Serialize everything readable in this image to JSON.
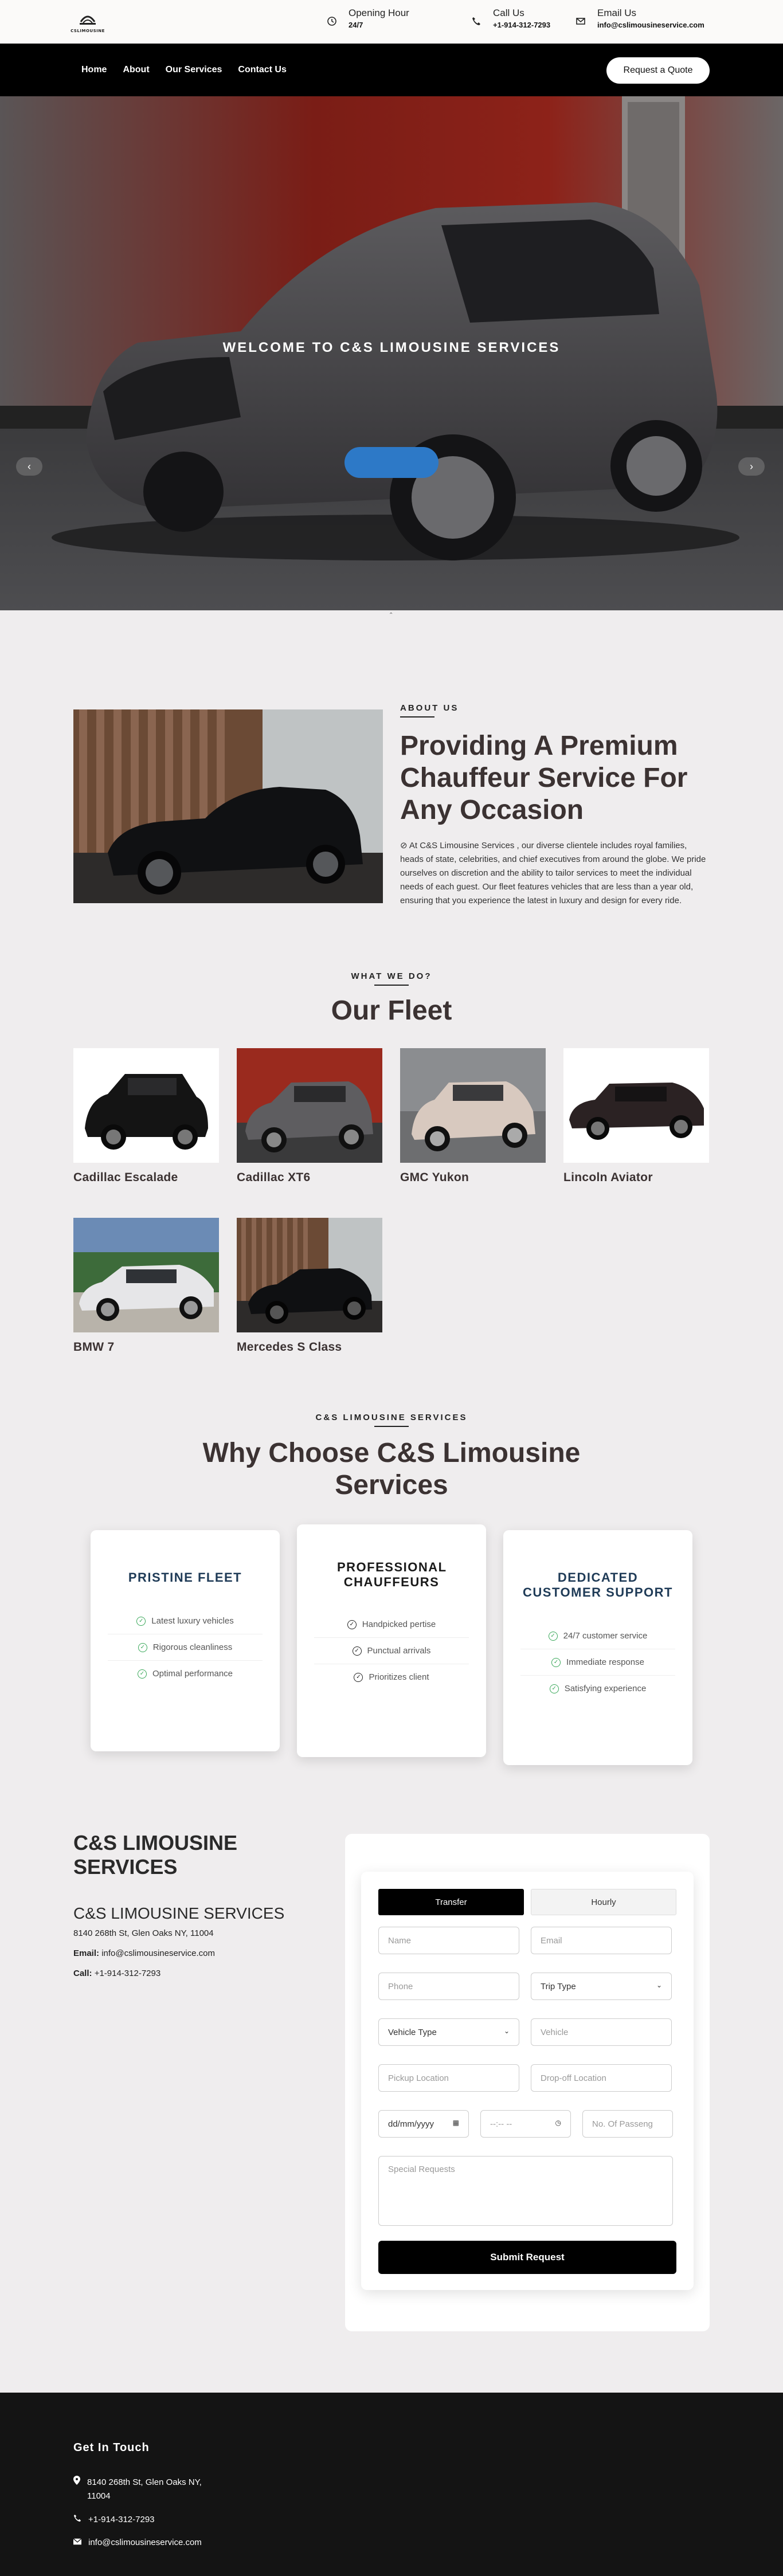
{
  "brand": {
    "logo_text": "CSLIMOUSINE"
  },
  "topbar": {
    "hours_label": "Opening Hour",
    "hours_value": "24/7",
    "call_label": "Call Us",
    "call_value": "+1-914-312-7293",
    "email_label": "Email Us",
    "email_value": "info@cslimousineservice.com"
  },
  "nav": {
    "items": [
      "Home",
      "About",
      "Our Services",
      "Contact Us"
    ],
    "quote_button": "Request a Quote"
  },
  "hero": {
    "title": "WELCOME TO C&S LIMOUSINE SERVICES",
    "prev": "‹",
    "next": "›",
    "dots": "⌃"
  },
  "about": {
    "tag": "ABOUT US",
    "heading": "Providing A Premium Chauffeur Service For Any Occasion",
    "body": "At C&S Limousine Services , our diverse clientele includes royal families, heads of state, celebrities, and chief executives from around the globe. We pride ourselves on discretion and the ability to tailor services to meet the individual needs of each guest. Our fleet features vehicles that are less than a year old, ensuring that you experience the latest in luxury and design for every ride."
  },
  "fleet": {
    "tag": "WHAT WE DO?",
    "heading": "Our Fleet",
    "cars": [
      "Cadillac Escalade",
      "Cadillac XT6",
      "GMC Yukon",
      "Lincoln Aviator",
      "BMW 7",
      "Mercedes S Class"
    ]
  },
  "why": {
    "tag": "C&S LIMOUSINE SERVICES",
    "heading": "Why Choose C&S Limousine Services",
    "cards": [
      {
        "title": "PRISTINE FLEET",
        "items": [
          "Latest luxury vehicles",
          "Rigorous cleanliness",
          "Optimal performance"
        ]
      },
      {
        "title": "PROFESSIONAL CHAUFFEURS",
        "items": [
          "Handpicked pertise",
          "Punctual arrivals",
          "Prioritizes client"
        ]
      },
      {
        "title": "DEDICATED CUSTOMER SUPPORT",
        "items": [
          "24/7 customer service",
          "Immediate response",
          "Satisfying experience"
        ]
      }
    ]
  },
  "company": {
    "title": "C&S LIMOUSINE SERVICES",
    "subtitle": "C&S LIMOUSINE SERVICES",
    "address": "8140 268th St, Glen Oaks NY, 11004",
    "email_label": "Email:",
    "email": "info@cslimousineservice.com",
    "call_label": "Call:",
    "call": "+1-914-312-7293"
  },
  "form": {
    "tab_transfer": "Transfer",
    "tab_hourly": "Hourly",
    "name": "Name",
    "email": "Email",
    "phone": "Phone",
    "trip_type": "Trip Type",
    "vehicle_type": "Vehicle Type",
    "vehicle": "Vehicle",
    "pickup": "Pickup Location",
    "dropoff": "Drop-off Location",
    "date": "dd/mm/yyyy",
    "time": "--:-- --",
    "passengers": "No. Of Passeng",
    "special": "Special Requests",
    "submit": "Submit Request"
  },
  "footer": {
    "heading": "Get In Touch",
    "address": "8140 268th St, Glen Oaks NY, 11004",
    "phone": "+1-914-312-7293",
    "email": "info@cslimousineservice.com"
  },
  "colors": {
    "accent_blue": "#2d79c7",
    "check_green": "#3aa85a",
    "card_title_navy": "#1f3b57",
    "heading_brown": "#3b3232"
  }
}
